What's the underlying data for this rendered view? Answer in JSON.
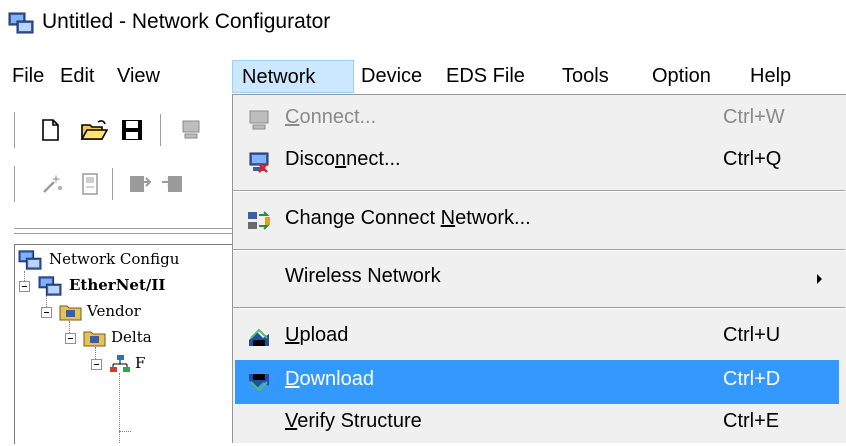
{
  "window": {
    "title": "Untitled - Network Configurator",
    "icon": "network-configurator-icon"
  },
  "menubar": {
    "items": [
      "File",
      "Edit",
      "View",
      "Network",
      "Device",
      "EDS File",
      "Tools",
      "Option",
      "Help"
    ],
    "active": "Network"
  },
  "toolbar": {
    "row1_icons": [
      "new-file-icon",
      "open-folder-icon",
      "save-icon",
      "connect-icon"
    ],
    "row2_icons": [
      "wizard-icon",
      "document-icon",
      "upload-icon",
      "download-icon"
    ]
  },
  "tree": {
    "items": [
      {
        "label": "Network Configu",
        "level": 0,
        "bold": false
      },
      {
        "label": "EtherNet/II",
        "level": 1,
        "bold": true
      },
      {
        "label": "Vendor",
        "level": 2,
        "bold": false
      },
      {
        "label": "Delta",
        "level": 3,
        "bold": false
      },
      {
        "label": "F",
        "level": 4,
        "bold": false
      }
    ]
  },
  "network_menu": {
    "connect": {
      "pre": "",
      "key": "C",
      "post": "onnect...",
      "shortcut": "Ctrl+W",
      "disabled": true
    },
    "disconnect": {
      "pre": "Disco",
      "key": "n",
      "post": "nect...",
      "shortcut": "Ctrl+Q"
    },
    "change_network": {
      "pre": "Change Connect ",
      "key": "N",
      "post": "etwork..."
    },
    "wireless": {
      "label": "Wireless Network"
    },
    "upload": {
      "pre": "",
      "key": "U",
      "post": "pload",
      "shortcut": "Ctrl+U"
    },
    "download": {
      "pre": "",
      "key": "D",
      "post": "ownload",
      "shortcut": "Ctrl+D",
      "highlighted": true
    },
    "verify": {
      "pre": "",
      "key": "V",
      "post": "erify Structure",
      "shortcut": "Ctrl+E"
    }
  },
  "colors": {
    "highlight": "#3399ff",
    "menu_active_bg": "#cce8ff",
    "menu_bg": "#f0f0f0"
  }
}
